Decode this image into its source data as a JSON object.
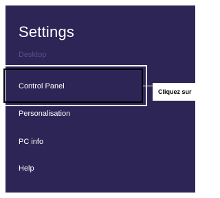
{
  "header": {
    "title": "Settings",
    "subtitle": "Desktop"
  },
  "menu": {
    "items": [
      {
        "label": "Control Panel"
      },
      {
        "label": "Personalisation"
      },
      {
        "label": "PC info"
      },
      {
        "label": "Help"
      }
    ]
  },
  "callout": {
    "text": "Cliquez sur"
  },
  "colors": {
    "panel_bg": "#2e2557",
    "subtitle": "#5b4f8f",
    "highlight_outer": "#ffffff",
    "highlight_inner": "#000000"
  }
}
